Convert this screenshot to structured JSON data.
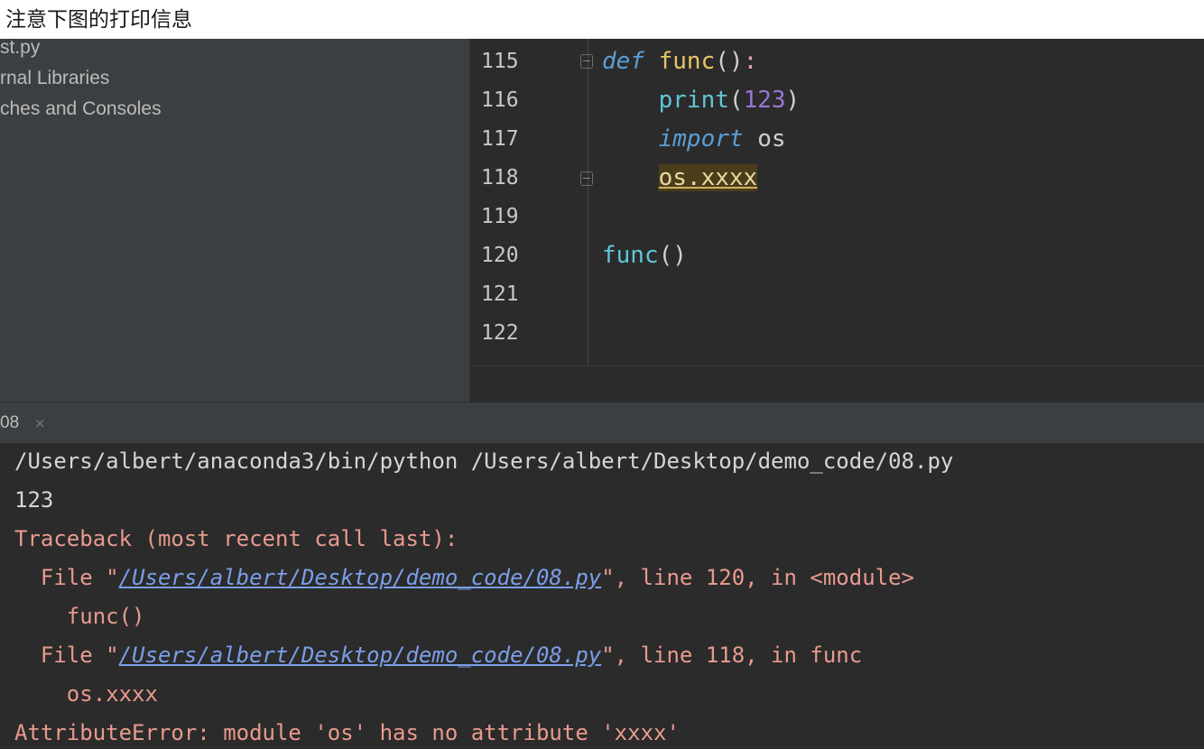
{
  "caption": "注意下图的打印信息",
  "project_tree": {
    "items": [
      {
        "label": "st.py"
      },
      {
        "label": "rnal Libraries"
      },
      {
        "label": "ches and Consoles"
      }
    ]
  },
  "editor": {
    "line_numbers": [
      "115",
      "116",
      "117",
      "118",
      "119",
      "120",
      "121",
      "122"
    ],
    "code": {
      "l115_kw": "def",
      "l115_name": "func",
      "l115_parens": "()",
      "l115_colon": ":",
      "l116_indent": "    ",
      "l116_fn": "print",
      "l116_open": "(",
      "l116_num": "123",
      "l116_close": ")",
      "l117_indent": "    ",
      "l117_kw": "import",
      "l117_mod": " os",
      "l118_indent": "    ",
      "l118_expr": "os.xxxx",
      "l120_call": "func",
      "l120_parens": "()"
    }
  },
  "run_tab": {
    "label": "08",
    "close_glyph": "×"
  },
  "console": {
    "cmd": "/Users/albert/anaconda3/bin/python /Users/albert/Desktop/demo_code/08.py",
    "output": "123",
    "traceback_header": "Traceback (most recent call last):",
    "frame1_prefix": "  File \"",
    "frame1_path": "/Users/albert/Desktop/demo_code/08.py",
    "frame1_suffix": "\", line 120, in <module>",
    "frame1_code": "    func()",
    "frame2_prefix": "  File \"",
    "frame2_path": "/Users/albert/Desktop/demo_code/08.py",
    "frame2_suffix": "\", line 118, in func",
    "frame2_code": "    os.xxxx",
    "error": "AttributeError: module 'os' has no attribute 'xxxx'"
  },
  "colors": {
    "editor_bg": "#2b2b2b",
    "panel_bg": "#3c3f41",
    "error_text": "#e99a8e",
    "link": "#7b9ee8",
    "keyword": "#5b9ed6",
    "number": "#9876d6"
  }
}
